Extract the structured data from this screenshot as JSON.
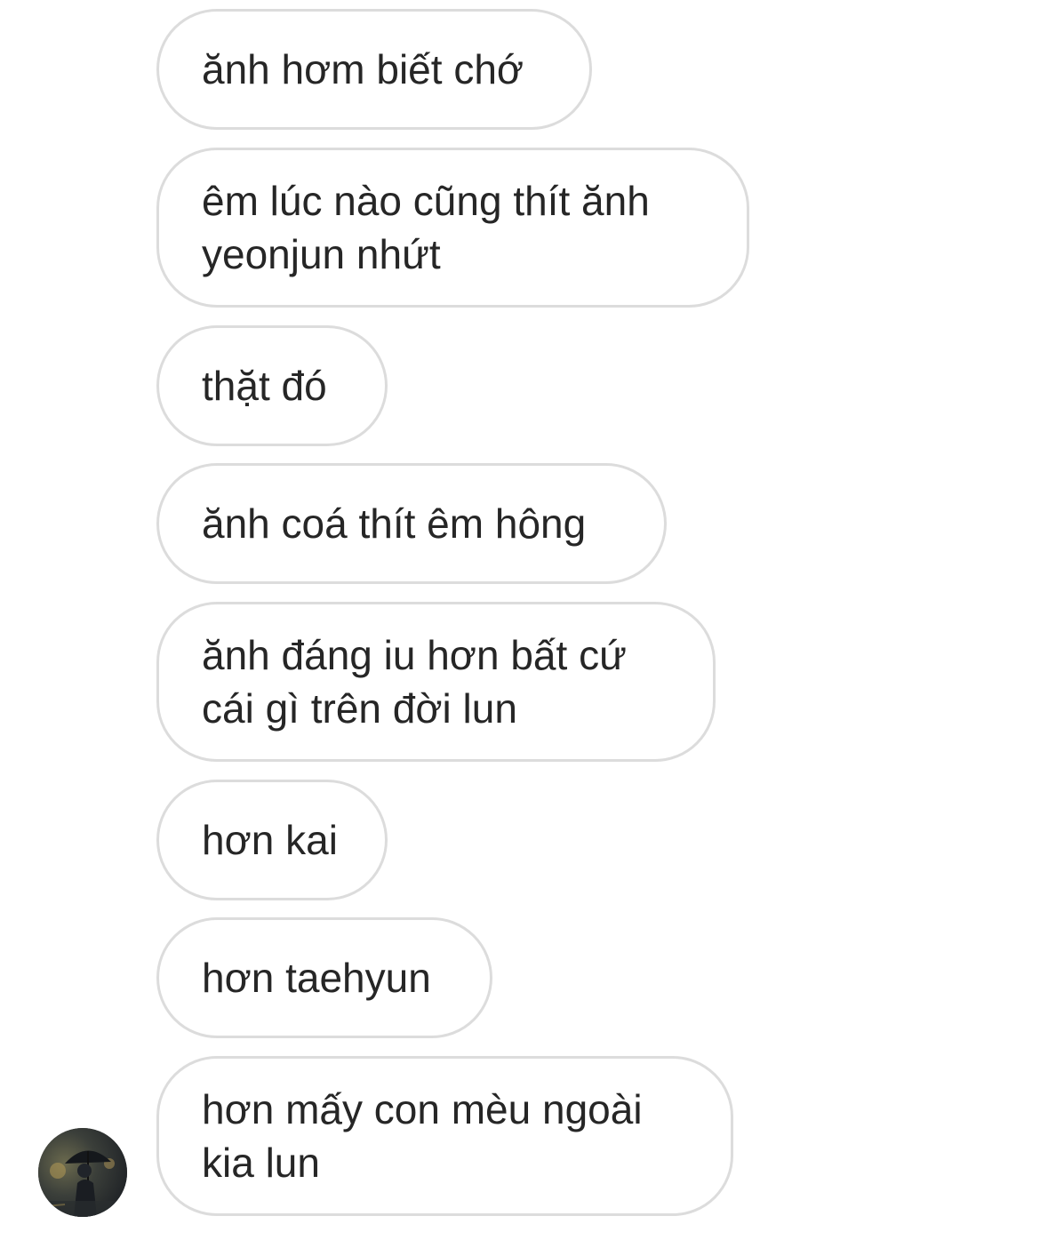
{
  "messages": [
    {
      "text": "ănh hơm biết chớ"
    },
    {
      "text": "êm lúc nào cũng thít ănh\nyeonjun nhứt"
    },
    {
      "text": "thặt đó"
    },
    {
      "text": "ănh coá thít êm hông"
    },
    {
      "text": "ănh đáng iu hơn bất cứ\ncái gì trên đời lun"
    },
    {
      "text": "hơn kai"
    },
    {
      "text": "hơn taehyun"
    },
    {
      "text": "hơn mấy con mèu ngoài\nkia lun"
    }
  ],
  "sender": {
    "avatar_icon": "profile-photo"
  },
  "colors": {
    "bubble_border": "#dcdcdc",
    "text": "#262626",
    "background": "#ffffff"
  }
}
